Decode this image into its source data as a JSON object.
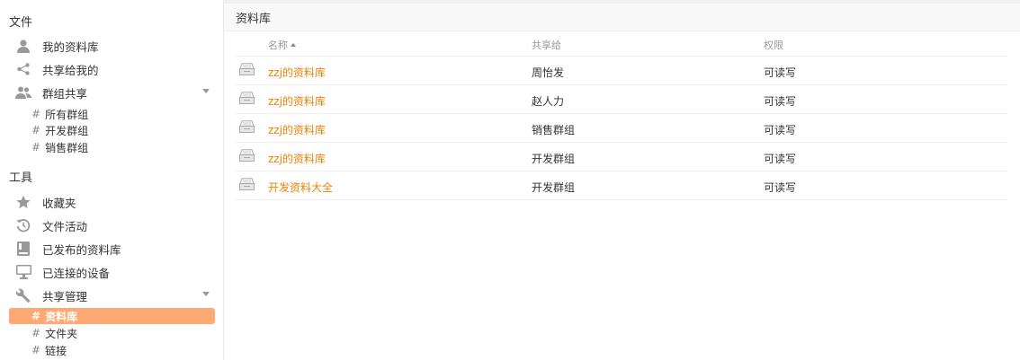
{
  "sidebar": {
    "files_section": "文件",
    "files_items": [
      {
        "label": "我的资料库",
        "icon": "user-icon"
      },
      {
        "label": "共享给我的",
        "icon": "share-icon"
      },
      {
        "label": "群组共享",
        "icon": "group-icon"
      }
    ],
    "groups": [
      "所有群组",
      "开发群组",
      "销售群组"
    ],
    "tools_section": "工具",
    "tools_items": [
      {
        "label": "收藏夹",
        "icon": "star-icon"
      },
      {
        "label": "文件活动",
        "icon": "history-icon"
      },
      {
        "label": "已发布的资料库",
        "icon": "book-icon"
      },
      {
        "label": "已连接的设备",
        "icon": "monitor-icon"
      },
      {
        "label": "共享管理",
        "icon": "wrench-icon"
      }
    ],
    "share_admin": [
      "资料库",
      "文件夹",
      "链接"
    ],
    "hash": "#"
  },
  "main": {
    "path_title": "资料库",
    "columns": {
      "name": "名称",
      "shared_to": "共享给",
      "permission": "权限"
    },
    "rows": [
      {
        "name": "zzj的资料库",
        "shared_to": "周怡发",
        "permission": "可读写"
      },
      {
        "name": "zzj的资料库",
        "shared_to": "赵人力",
        "permission": "可读写"
      },
      {
        "name": "zzj的资料库",
        "shared_to": "销售群组",
        "permission": "可读写"
      },
      {
        "name": "zzj的资料库",
        "shared_to": "开发群组",
        "permission": "可读写"
      },
      {
        "name": "开发资料大全",
        "shared_to": "开发群组",
        "permission": "可读写"
      }
    ]
  },
  "colors": {
    "accent": "#eb8205",
    "active_bg": "#fea974"
  }
}
